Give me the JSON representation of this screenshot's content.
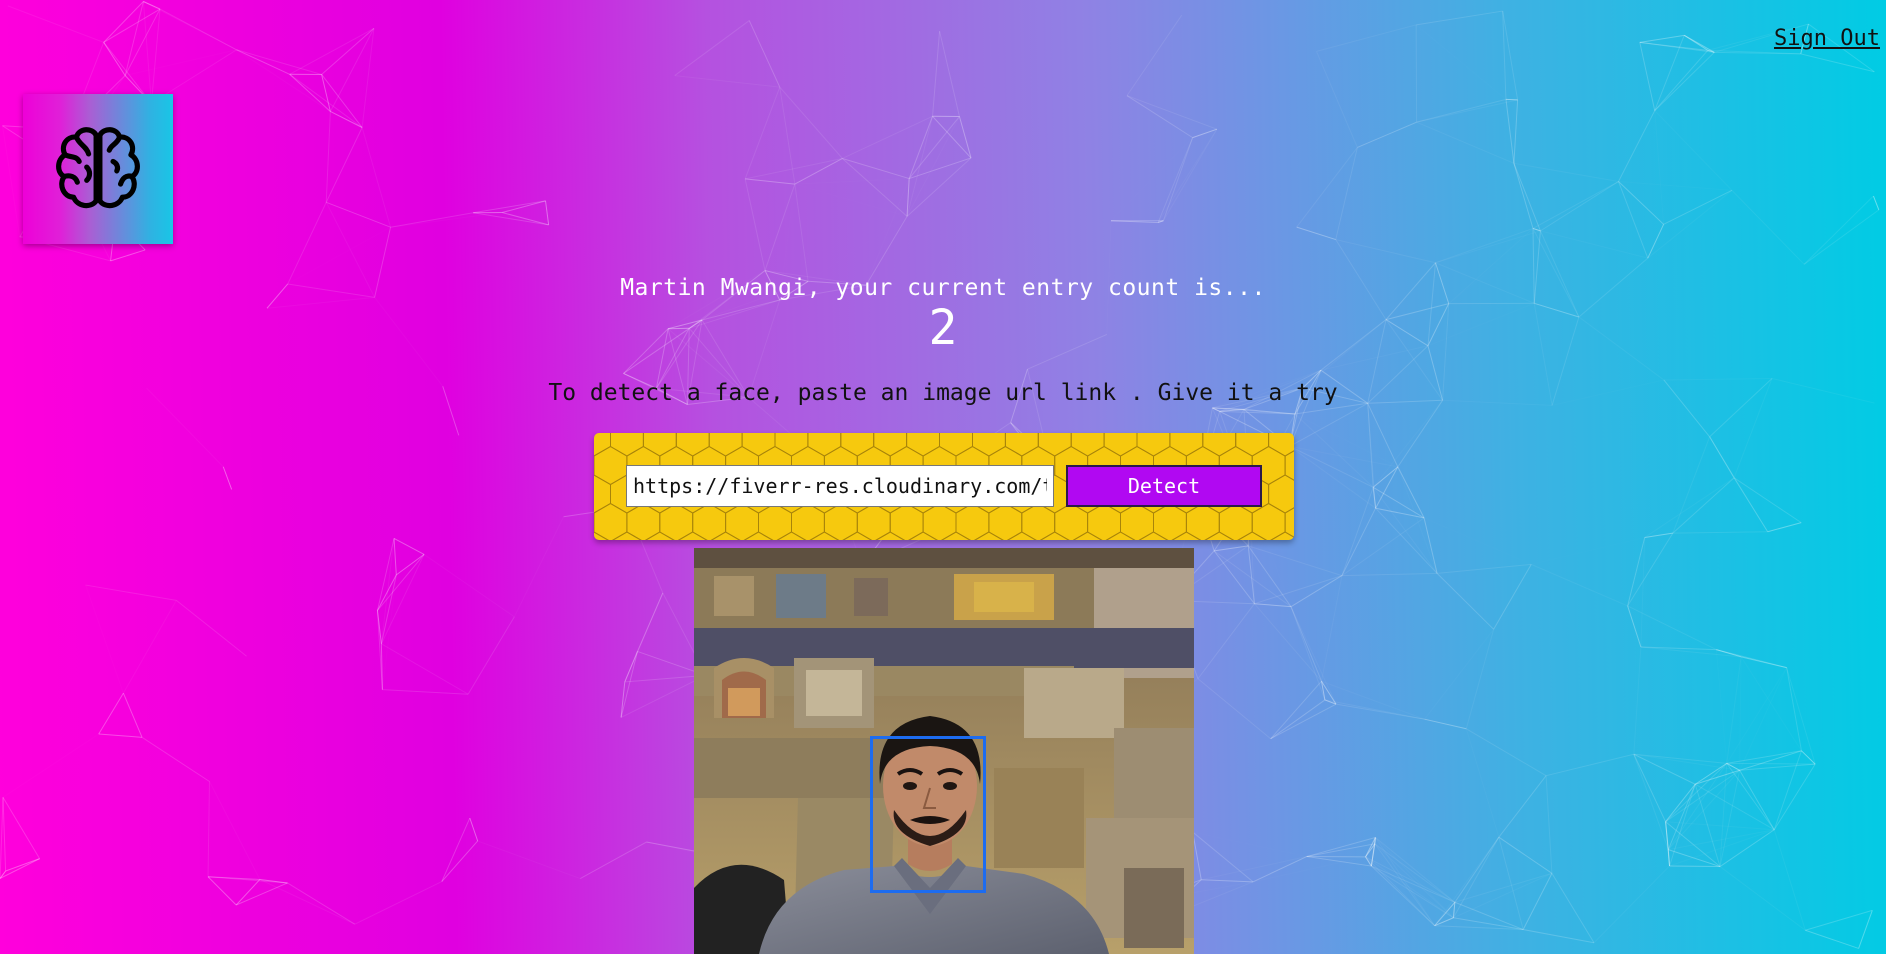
{
  "nav": {
    "signout_label": "Sign Out"
  },
  "logo": {
    "icon": "brain-icon"
  },
  "rank": {
    "greeting": "Martin Mwangi, your current entry count is...",
    "count": "2"
  },
  "prompt": "To detect a face, paste an image url link . Give it a try",
  "form": {
    "input_value": "https://fiverr-res.cloudinary.com/t_",
    "detect_label": "Detect"
  },
  "colors": {
    "accent": "#b108f2",
    "form_bg": "#f6c90e",
    "face_box": "#1d6cf0"
  }
}
